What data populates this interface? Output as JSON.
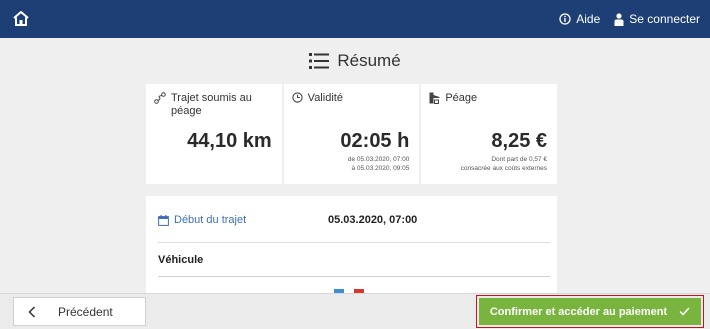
{
  "topbar": {
    "help_label": "Aide",
    "login_label": "Se connecter",
    "color": "#1d3f76"
  },
  "summary": {
    "title": "Résumé"
  },
  "cards": {
    "distance": {
      "label": "Trajet soumis au péage",
      "value": "44,10 km",
      "icon": "route-icon"
    },
    "validity": {
      "label": "Validité",
      "value": "02:05 h",
      "from": "de 05.03.2020, 07:00",
      "to": "à 05.03.2020, 09:05",
      "icon": "clock-icon"
    },
    "toll": {
      "label": "Péage",
      "value": "8,25 €",
      "note_line1": "Dont part de 0,57 €",
      "note_line2": "consacrée aux coûts externes",
      "icon": "toll-icon"
    }
  },
  "details": {
    "start_label": "Début du trajet",
    "start_value": "05.03.2020, 07:00",
    "vehicle_section": "Véhicule"
  },
  "footer": {
    "back_label": "Précédent",
    "confirm_label": "Confirmer et accéder au paiement",
    "confirm_color": "#79b53e",
    "highlight_color": "#c3161c"
  }
}
